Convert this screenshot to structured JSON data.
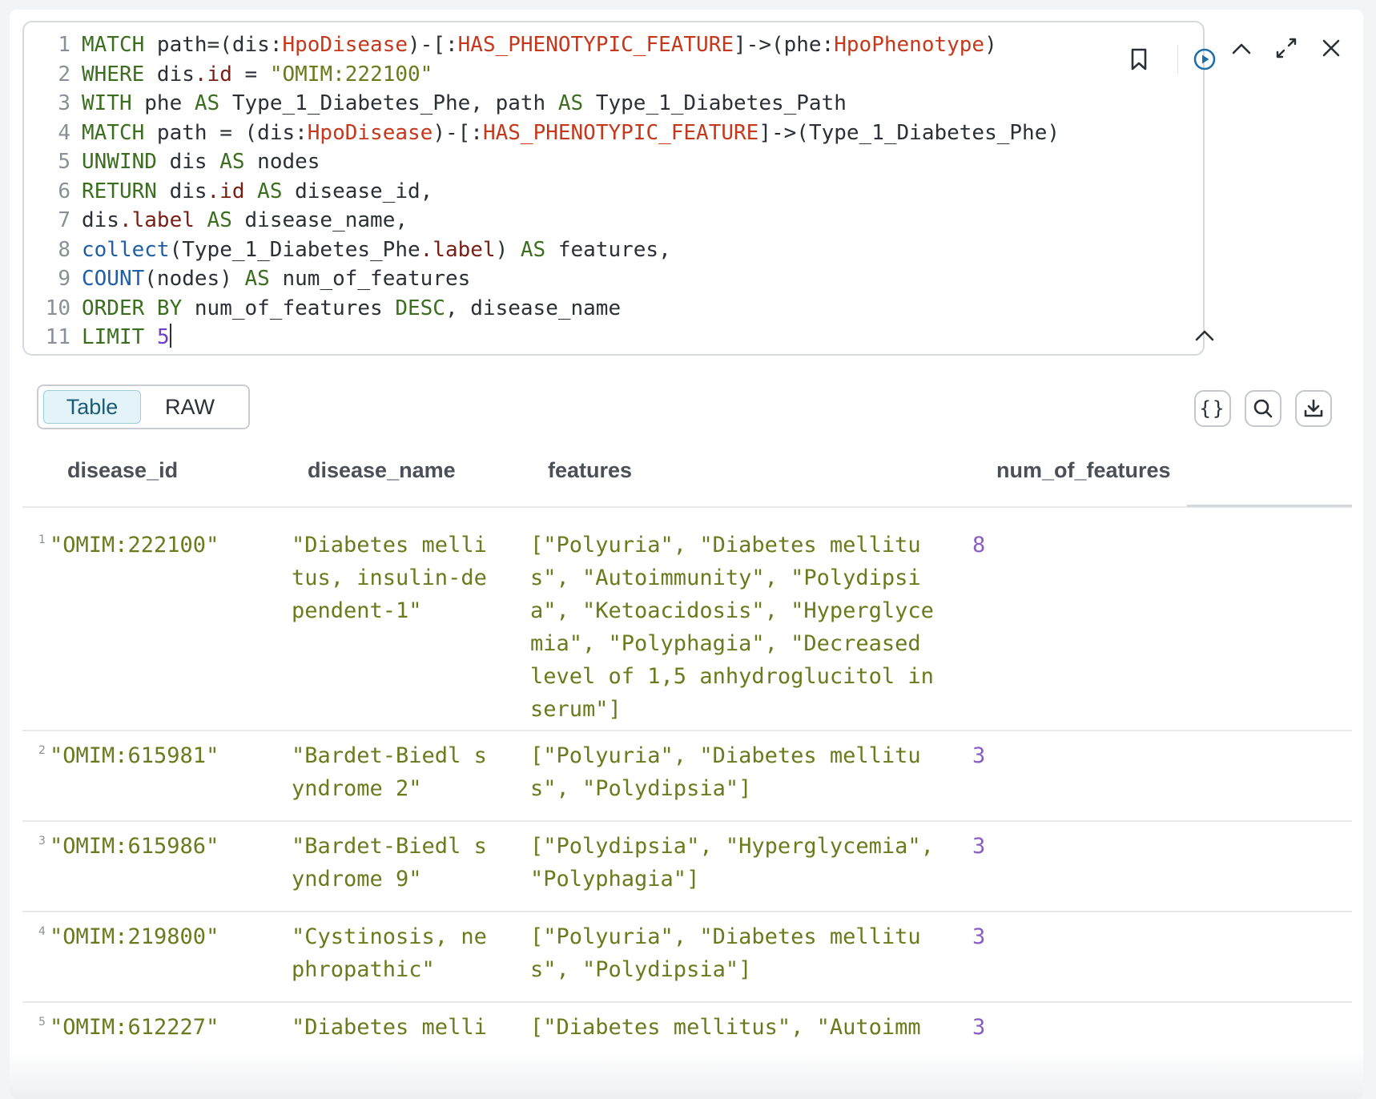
{
  "editor": {
    "lines": [
      {
        "n": "1",
        "tokens": [
          [
            "kw",
            "MATCH"
          ],
          [
            "plain",
            " path=(dis:"
          ],
          [
            "lbl",
            "HpoDisease"
          ],
          [
            "plain",
            ")-[:"
          ],
          [
            "lbl",
            "HAS_PHENOTYPIC_FEATURE"
          ],
          [
            "plain",
            "]->(phe:"
          ],
          [
            "lbl",
            "HpoPhenotype"
          ],
          [
            "plain",
            ")"
          ]
        ]
      },
      {
        "n": "2",
        "tokens": [
          [
            "kw",
            "WHERE"
          ],
          [
            "plain",
            " dis"
          ],
          [
            "prop",
            ".id"
          ],
          [
            "plain",
            " = "
          ],
          [
            "str",
            "\"OMIM:222100\""
          ]
        ]
      },
      {
        "n": "3",
        "tokens": [
          [
            "kw",
            "WITH"
          ],
          [
            "plain",
            " phe "
          ],
          [
            "kw",
            "AS"
          ],
          [
            "plain",
            " Type_1_Diabetes_Phe, path "
          ],
          [
            "kw",
            "AS"
          ],
          [
            "plain",
            " Type_1_Diabetes_Path"
          ]
        ]
      },
      {
        "n": "4",
        "tokens": [
          [
            "kw",
            "MATCH"
          ],
          [
            "plain",
            " path = (dis:"
          ],
          [
            "lbl",
            "HpoDisease"
          ],
          [
            "plain",
            ")-[:"
          ],
          [
            "lbl",
            "HAS_PHENOTYPIC_FEATURE"
          ],
          [
            "plain",
            "]->(Type_1_Diabetes_Phe)"
          ]
        ]
      },
      {
        "n": "5",
        "tokens": [
          [
            "kw",
            "UNWIND"
          ],
          [
            "plain",
            " dis "
          ],
          [
            "kw",
            "AS"
          ],
          [
            "plain",
            " nodes"
          ]
        ]
      },
      {
        "n": "6",
        "tokens": [
          [
            "kw",
            "RETURN"
          ],
          [
            "plain",
            " dis"
          ],
          [
            "prop",
            ".id"
          ],
          [
            "plain",
            " "
          ],
          [
            "kw",
            "AS"
          ],
          [
            "plain",
            " disease_id,"
          ]
        ]
      },
      {
        "n": "7",
        "tokens": [
          [
            "plain",
            "dis"
          ],
          [
            "prop",
            ".label"
          ],
          [
            "plain",
            " "
          ],
          [
            "kw",
            "AS"
          ],
          [
            "plain",
            " disease_name,"
          ]
        ]
      },
      {
        "n": "8",
        "tokens": [
          [
            "fn",
            "collect"
          ],
          [
            "plain",
            "(Type_1_Diabetes_Phe"
          ],
          [
            "prop",
            ".label"
          ],
          [
            "plain",
            ") "
          ],
          [
            "kw",
            "AS"
          ],
          [
            "plain",
            " features,"
          ]
        ]
      },
      {
        "n": "9",
        "tokens": [
          [
            "fn",
            "COUNT"
          ],
          [
            "plain",
            "(nodes) "
          ],
          [
            "kw",
            "AS"
          ],
          [
            "plain",
            " num_of_features"
          ]
        ]
      },
      {
        "n": "10",
        "tokens": [
          [
            "kw",
            "ORDER BY"
          ],
          [
            "plain",
            " num_of_features "
          ],
          [
            "kw",
            "DESC"
          ],
          [
            "plain",
            ", disease_name"
          ]
        ]
      },
      {
        "n": "11",
        "tokens": [
          [
            "kw",
            "LIMIT"
          ],
          [
            "plain",
            " "
          ],
          [
            "num",
            "5"
          ]
        ]
      }
    ]
  },
  "view_toggle": {
    "table_label": "Table",
    "raw_label": "RAW",
    "active": "Table"
  },
  "tools": {
    "json_label": "{}"
  },
  "table": {
    "columns": [
      "disease_id",
      "disease_name",
      "features",
      "num_of_features"
    ],
    "rows": [
      {
        "idx": "1",
        "disease_id": "\"OMIM:222100\"",
        "disease_name": "\"Diabetes mellitus, insulin-dependent-1\"",
        "features": "[\"Polyuria\", \"Diabetes mellitus\", \"Autoimmunity\", \"Polydipsia\", \"Ketoacidosis\", \"Hyperglycemia\", \"Polyphagia\", \"Decreased level of 1,5 anhydroglucitol in serum\"]",
        "num_of_features": "8"
      },
      {
        "idx": "2",
        "disease_id": "\"OMIM:615981\"",
        "disease_name": "\"Bardet-Biedl syndrome 2\"",
        "features": "[\"Polyuria\", \"Diabetes mellitus\", \"Polydipsia\"]",
        "num_of_features": "3"
      },
      {
        "idx": "3",
        "disease_id": "\"OMIM:615986\"",
        "disease_name": "\"Bardet-Biedl syndrome 9\"",
        "features": "[\"Polydipsia\", \"Hyperglycemia\", \"Polyphagia\"]",
        "num_of_features": "3"
      },
      {
        "idx": "4",
        "disease_id": "\"OMIM:219800\"",
        "disease_name": "\"Cystinosis, nephropathic\"",
        "features": "[\"Polyuria\", \"Diabetes mellitus\", \"Polydipsia\"]",
        "num_of_features": "3"
      },
      {
        "idx": "5",
        "disease_id": "\"OMIM:612227\"",
        "disease_name": "\"Diabetes melli",
        "features": "[\"Diabetes mellitus\", \"Autoimm",
        "num_of_features": "3"
      }
    ]
  },
  "colors": {
    "keyword": "#3b6e1f",
    "label": "#c5381c",
    "string": "#6b7a1c",
    "property": "#7a1e13",
    "function": "#1f5fa8",
    "number": "#6c3fc5",
    "accent": "#1c5b78"
  },
  "icons": [
    "bookmark-icon",
    "run-icon",
    "collapse-up-icon",
    "expand-icon",
    "close-icon",
    "editor-collapse-icon",
    "json-icon",
    "search-icon",
    "download-icon"
  ]
}
